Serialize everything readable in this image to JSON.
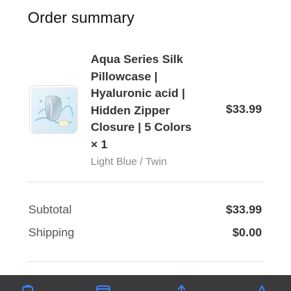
{
  "section_title": "Order summary",
  "line_item": {
    "name": "Aqua Series Silk Pillowcase | Hyaluronic acid | Hidden Zipper Closure | 5 Colors × 1",
    "variant": "Light Blue / Twin",
    "price": "$33.99",
    "image_icon": "silk-pillowcase-product-image"
  },
  "totals": {
    "subtotal_label": "Subtotal",
    "subtotal_value": "$33.99",
    "shipping_label": "Shipping",
    "shipping_value": "$0.00"
  },
  "bottom_bar": {
    "icons": [
      "bag-icon",
      "card-icon",
      "arrow-up-icon",
      "share-icon"
    ],
    "icon_color": "#3b82f6",
    "background": "#3a3a3c"
  }
}
